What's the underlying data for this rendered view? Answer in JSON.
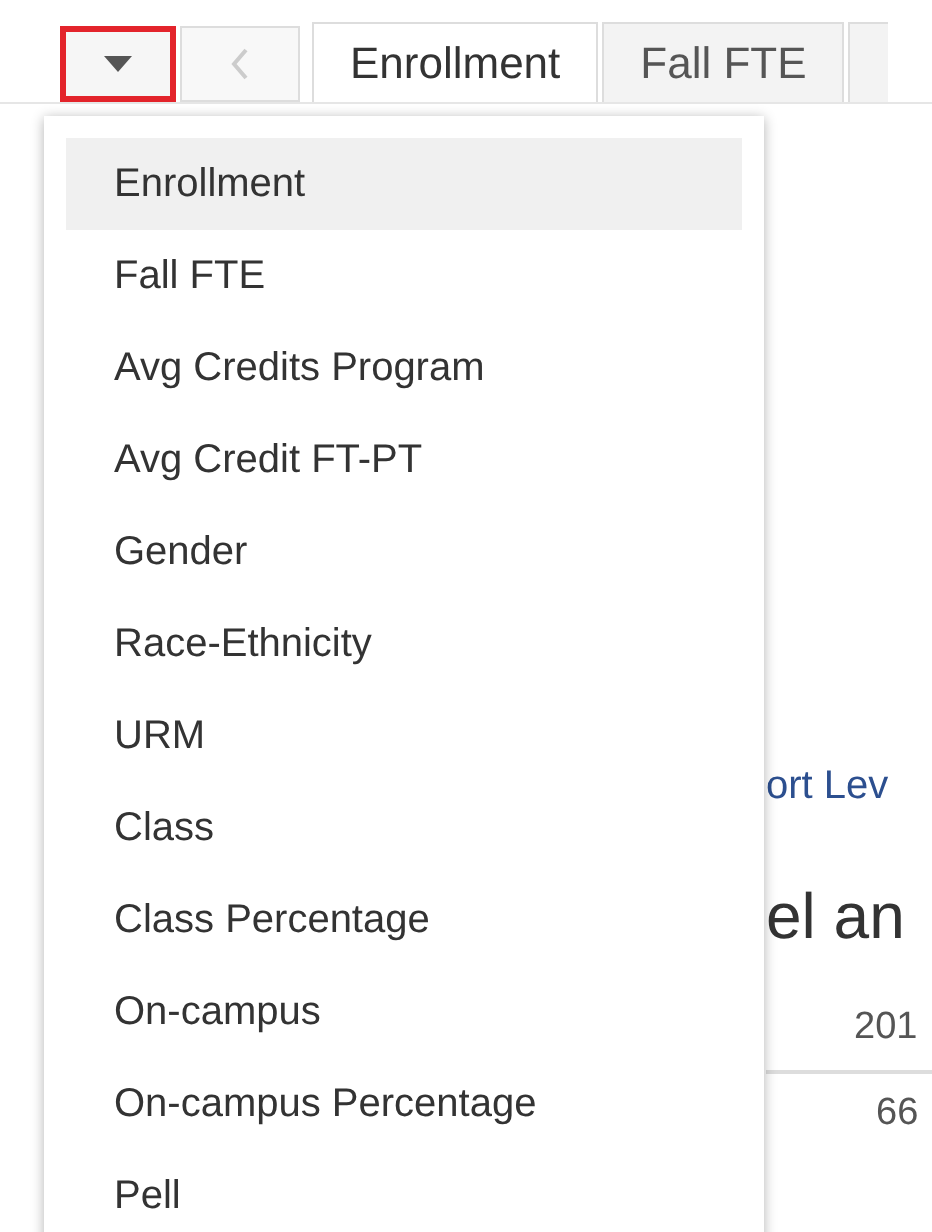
{
  "toolbar": {
    "menu_button": {
      "highlighted": true
    },
    "prev_button": {
      "disabled": true
    }
  },
  "tabs": [
    {
      "label": "Enrollment",
      "selected": true
    },
    {
      "label": "Fall FTE",
      "selected": false
    }
  ],
  "menu": {
    "items": [
      {
        "label": "Enrollment",
        "selected": true
      },
      {
        "label": "Fall FTE",
        "selected": false
      },
      {
        "label": "Avg Credits Program",
        "selected": false
      },
      {
        "label": "Avg Credit FT-PT",
        "selected": false
      },
      {
        "label": "Gender",
        "selected": false
      },
      {
        "label": "Race-Ethnicity",
        "selected": false
      },
      {
        "label": "URM",
        "selected": false
      },
      {
        "label": "Class",
        "selected": false
      },
      {
        "label": "Class Percentage",
        "selected": false
      },
      {
        "label": "On-campus",
        "selected": false
      },
      {
        "label": "On-campus Percentage",
        "selected": false
      },
      {
        "label": "Pell",
        "selected": false
      }
    ]
  },
  "background": {
    "subtitle": "ort Lev",
    "heading": "el an",
    "column_header": "201",
    "cell": "66"
  }
}
